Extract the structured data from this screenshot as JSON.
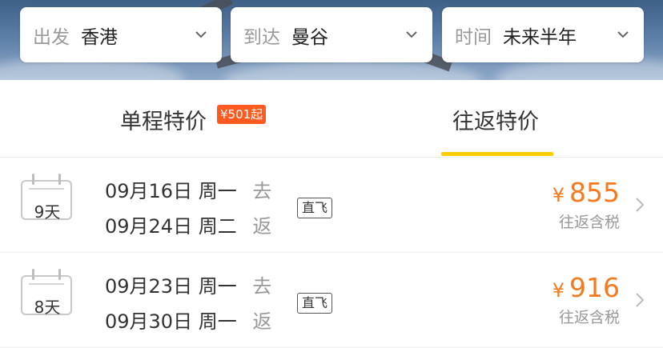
{
  "filters": [
    {
      "label": "出发",
      "value": "香港"
    },
    {
      "label": "到达",
      "value": "曼谷"
    },
    {
      "label": "时间",
      "value": "未来半年"
    }
  ],
  "tabs": {
    "one_way": {
      "label": "单程特价",
      "badge": "¥501起"
    },
    "round_trip": {
      "label": "往返特价",
      "active": true
    }
  },
  "deals": [
    {
      "days": "9天",
      "depart": {
        "date": "09月16日",
        "weekday": "周一",
        "dir": "去"
      },
      "return": {
        "date": "09月24日",
        "weekday": "周二",
        "dir": "返"
      },
      "tag": "直飞",
      "currency": "¥",
      "price": "855",
      "note": "往返含税"
    },
    {
      "days": "8天",
      "depart": {
        "date": "09月23日",
        "weekday": "周一",
        "dir": "去"
      },
      "return": {
        "date": "09月30日",
        "weekday": "周一",
        "dir": "返"
      },
      "tag": "直飞",
      "currency": "¥",
      "price": "916",
      "note": "往返含税"
    }
  ],
  "colors": {
    "accent_price": "#f57a1f",
    "badge": "#ff5a1f",
    "tab_underline": "#ffcc00"
  },
  "icons": {
    "filter_chevron": "chevron-down-icon",
    "row_chevron": "chevron-right-icon",
    "calendar": "calendar-icon"
  }
}
